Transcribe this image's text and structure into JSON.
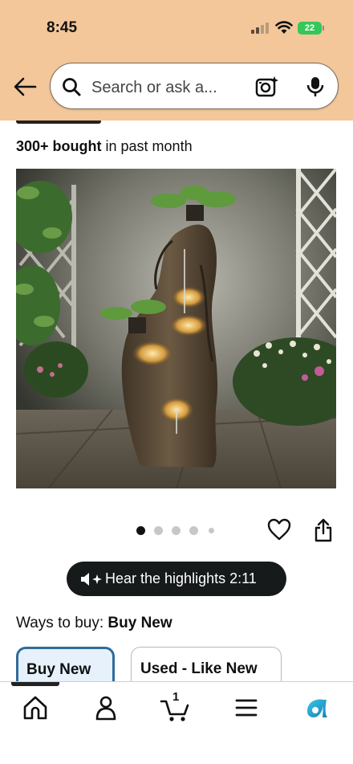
{
  "status_bar": {
    "time": "8:45",
    "battery": "22",
    "icons": [
      "signal-icon",
      "wifi-icon",
      "battery-icon"
    ]
  },
  "header": {
    "back_icon": "back-arrow-icon",
    "search_placeholder": "Search or ask a...",
    "lens_icon": "camera-search-icon",
    "mic_icon": "mic-icon"
  },
  "product": {
    "bought_count": "300+ bought",
    "bought_suffix": " in past month",
    "image_alt": "Tree-trunk tiered water fountain with lights",
    "image_count": 5,
    "active_image": 1
  },
  "actions": {
    "heart_icon": "heart-icon",
    "share_icon": "share-icon"
  },
  "highlights": {
    "label": "Hear the highlights 2:11",
    "icon": "speaker-sparkle-icon"
  },
  "ways_to_buy": {
    "label": "Ways to buy: ",
    "selected": "Buy New",
    "options": [
      {
        "label": "Buy New",
        "selected": true
      },
      {
        "label": "Used - Like New",
        "selected": false
      }
    ]
  },
  "bottom_nav": {
    "items": [
      {
        "name": "home",
        "icon": "home-icon"
      },
      {
        "name": "account",
        "icon": "person-icon"
      },
      {
        "name": "cart",
        "icon": "cart-icon",
        "count": "1"
      },
      {
        "name": "menu",
        "icon": "menu-icon"
      },
      {
        "name": "rufus",
        "icon": "rufus-icon"
      }
    ]
  },
  "colors": {
    "header_bg": "#f3c799",
    "selected_border": "#2e6c9c",
    "selected_bg": "#e6f1fb",
    "pill_bg": "#171a1a",
    "rufus": "#1aa1c4"
  }
}
